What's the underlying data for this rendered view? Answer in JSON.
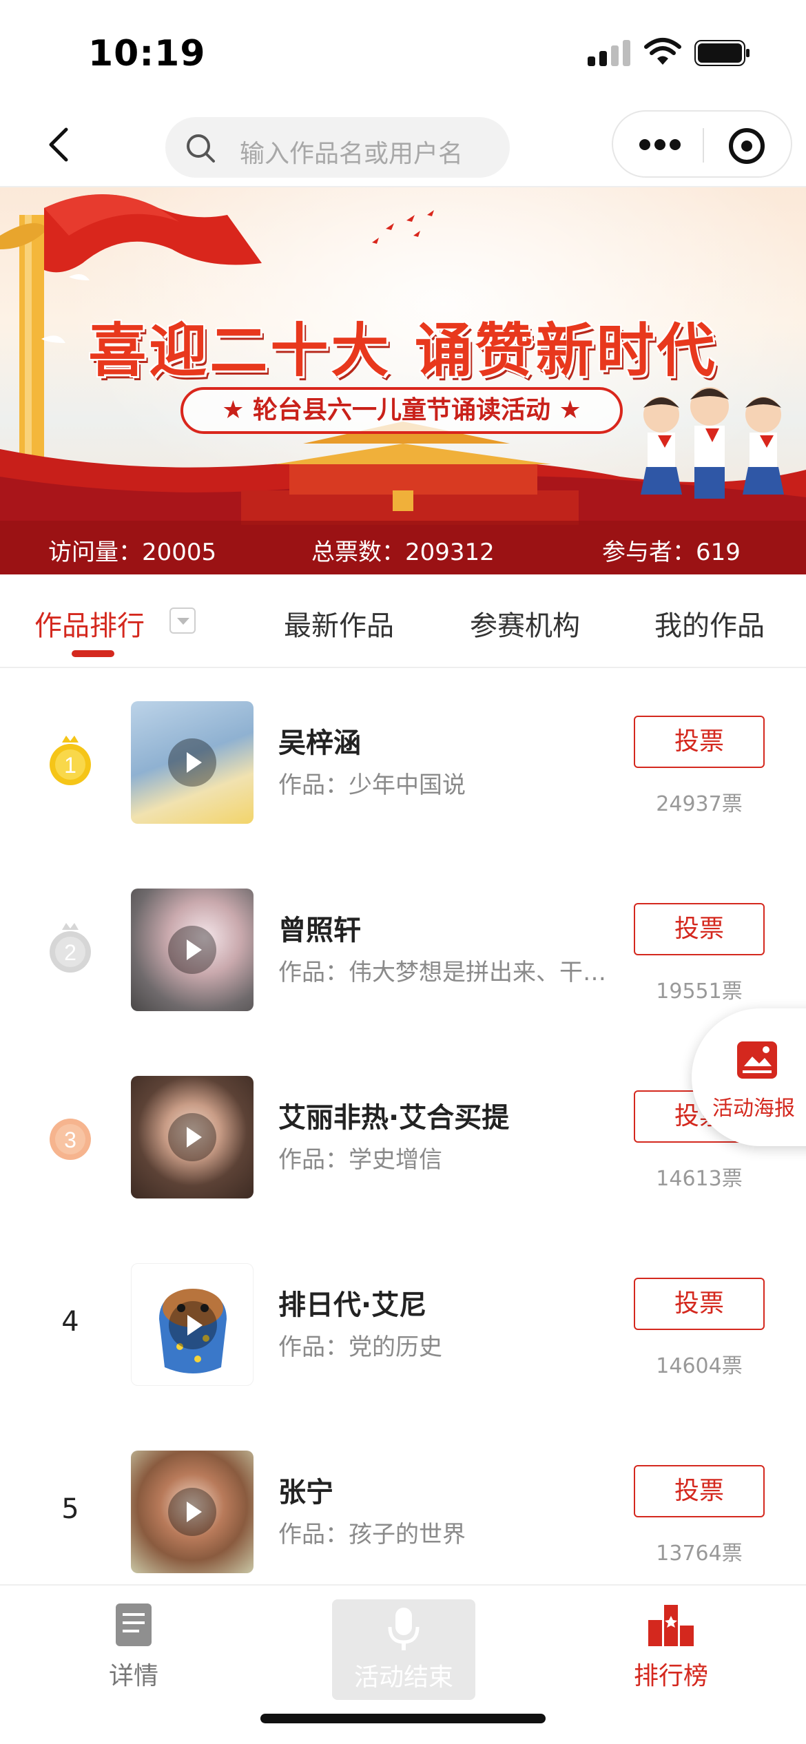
{
  "status_bar": {
    "time": "10:19"
  },
  "nav": {
    "search_placeholder": "输入作品名或用户名"
  },
  "banner": {
    "title": "喜迎二十大  诵赞新时代",
    "subtitle": "★ 轮台县六一儿童节诵读活动 ★",
    "stats": {
      "visits": "访问量：20005",
      "total_votes": "总票数：209312",
      "participants": "参与者：619"
    }
  },
  "tabs": [
    {
      "label": "作品排行",
      "active": true
    },
    {
      "label": "最新作品",
      "active": false
    },
    {
      "label": "参赛机构",
      "active": false
    },
    {
      "label": "我的作品",
      "active": false
    }
  ],
  "vote_label": "投票",
  "entries": [
    {
      "rank": "1",
      "name": "吴梓涵",
      "work": "作品：少年中国说",
      "votes": "24937票"
    },
    {
      "rank": "2",
      "name": "曾照轩",
      "work": "作品：伟大梦想是拼出来、干…",
      "votes": "19551票"
    },
    {
      "rank": "3",
      "name": "艾丽非热·艾合买提",
      "work": "作品：学史增信",
      "votes": "14613票"
    },
    {
      "rank": "4",
      "name": "排日代·艾尼",
      "work": "作品：党的历史",
      "votes": "14604票"
    },
    {
      "rank": "5",
      "name": "张宁",
      "work": "作品：孩子的世界",
      "votes": "13764票"
    }
  ],
  "poster_button": {
    "label": "活动海报"
  },
  "bottom_bar": {
    "details": "详情",
    "record": "活动结束",
    "ranking": "排行榜"
  },
  "colors": {
    "accent": "#d4281e",
    "gold": "#f5c518",
    "silver": "#cfcfcf",
    "bronze": "#f2a57a"
  }
}
